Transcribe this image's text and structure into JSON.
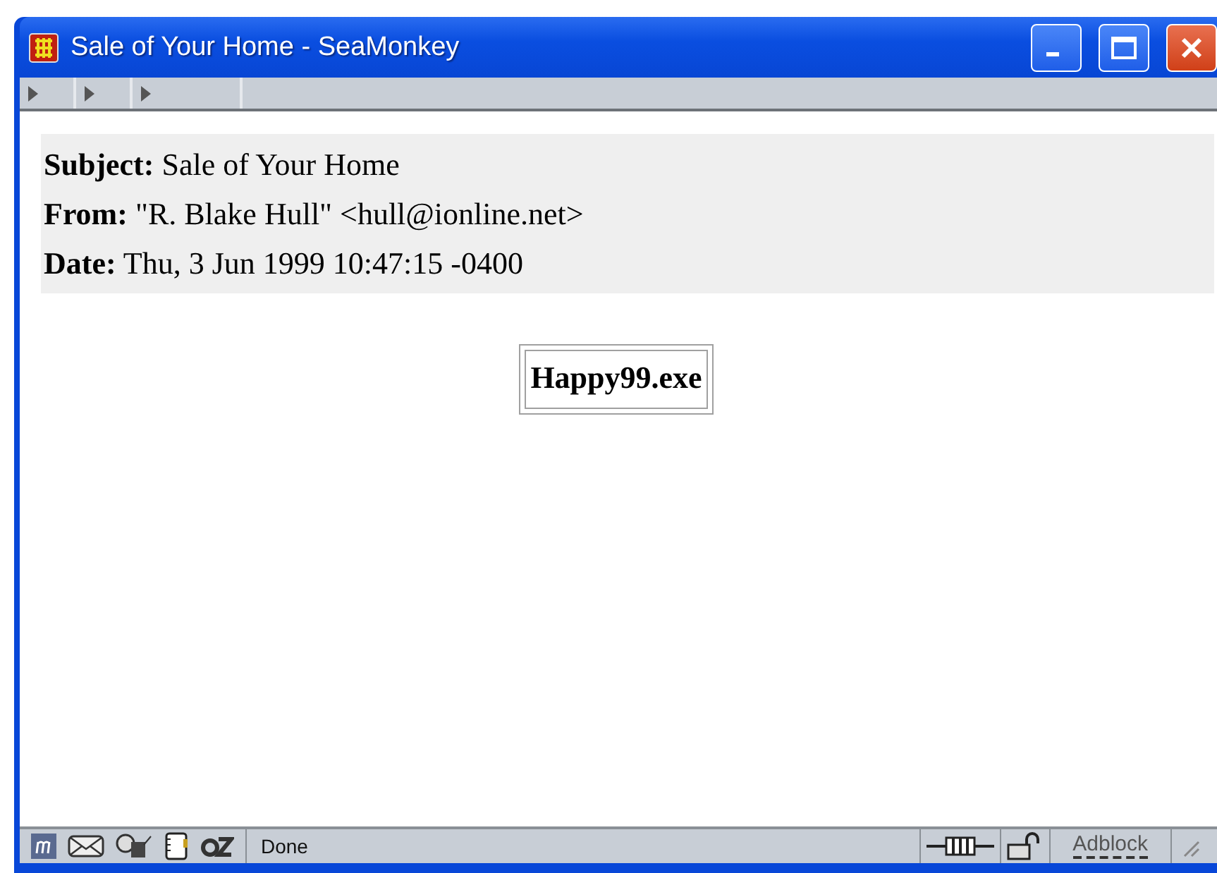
{
  "window": {
    "title": "Sale of Your Home - SeaMonkey"
  },
  "headers": [
    {
      "label": "Subject:",
      "value": "Sale of Your Home"
    },
    {
      "label": "From:",
      "value": "\"R. Blake Hull\" <hull@ionline.net>"
    },
    {
      "label": "Date:",
      "value": "Thu, 3 Jun 1999 10:47:15 -0400"
    }
  ],
  "attachment": {
    "name": "Happy99.exe"
  },
  "status_bar": {
    "status": "Done",
    "adblock": "Adblock"
  }
}
